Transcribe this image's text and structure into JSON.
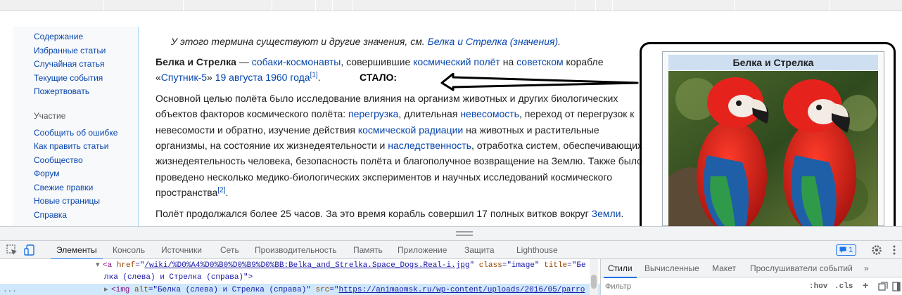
{
  "sidebar": {
    "nav": [
      "Содержание",
      "Избранные статьи",
      "Случайная статья",
      "Текущие события",
      "Пожертвовать"
    ],
    "heading": "Участие",
    "participate": [
      "Сообщить об ошибке",
      "Как править статьи",
      "Сообщество",
      "Форум",
      "Свежие правки",
      "Новые страницы",
      "Справка"
    ]
  },
  "article": {
    "hatnote_prefix": "У этого термина существуют и другие значения, см.",
    "hatnote_link": "Белка и Стрелка (значения)",
    "hatnote_suffix": ".",
    "p1": {
      "bold": "Белка и Стрелка",
      "t1": " — ",
      "l1": "собаки-космонавты",
      "t2": ", совершившие ",
      "l2": "космический полёт",
      "t3": " на ",
      "l3": "советском",
      "t4": " корабле",
      "t5": "«",
      "l4": "Спутник-5",
      "t6": "» ",
      "l5": "19 августа",
      "t7": " ",
      "l6": "1960 года",
      "ref": "[1]",
      "t8": "."
    },
    "stalo": "СТАЛО:",
    "p2": {
      "line1": "Основной целью полёта было исследование влияния на организм животных и других биологических",
      "line2_t1": "объектов факторов космического полёта: ",
      "line2_l1": "перегрузка",
      "line2_t2": ", длительная ",
      "line2_l2": "невесомость",
      "line2_t3": ", переход от перегрузок к",
      "line3_t1": "невесомости и обратно, изучение действия ",
      "line3_l1": "космической радиации",
      "line3_t2": " на животных и растительные",
      "line4_t1": "организмы, на состояние их жизнедеятельности и ",
      "line4_l1": "наследственность",
      "line4_t2": ", отработка систем, обеспечивающих",
      "line5": "жизнедеятельность человека, безопасность полёта и благополучное возвращение на Землю. Также было",
      "line6": "проведено несколько медико-биологических экспериментов и научных исследований космического",
      "line7": "пространства",
      "ref": "[2]",
      "line7_end": "."
    },
    "p3": {
      "t1": "Полёт продолжался более 25 часов. За это время корабль совершил 17 полных витков вокруг ",
      "l1": "Земли",
      "t2": "."
    }
  },
  "infobox": {
    "title": "Белка и Стрелка",
    "image_icon": "parrots-image"
  },
  "devtools": {
    "tabs": [
      "Элементы",
      "Консоль",
      "Источники",
      "Сеть",
      "Производительность",
      "Память",
      "Приложение",
      "Защита",
      "Lighthouse"
    ],
    "active_tab": "Элементы",
    "badge": "1",
    "line1": {
      "tag_open": "<a ",
      "attr1": "href",
      "eq": "=\"",
      "url": "/wiki/%D0%A4%D0%B0%D0%B9%D0%BB:Belka_and_Strelka.Space_Dogs.Real-i.jpg",
      "q": "\" ",
      "attr2": "class",
      "val2": "\"image\"",
      "attr3": "title",
      "val3": "=\"Бе"
    },
    "line2": "лка (слева) и Стрелка (справа)\">",
    "line3": {
      "tag_open": "<img ",
      "attr1": "alt",
      "val1": "=\"Белка (слева) и Стрелка (справа)\" ",
      "attr2": "src",
      "eq": "=\"",
      "url": "https://animaomsk.ru/wp-content/uploads/2016/05/parro"
    },
    "gutter": "...",
    "styles_tabs": [
      "Стили",
      "Вычисленные",
      "Макет",
      "Прослушиватели событий"
    ],
    "styles_active": "Стили",
    "more": "»",
    "filter_placeholder": "Фильтр",
    "hov": ":hov",
    "cls": ".cls",
    "plus": "+"
  },
  "colors": {
    "link": "#0645ad",
    "accent": "#1a73e8",
    "infobox_title": "#cedff2"
  }
}
